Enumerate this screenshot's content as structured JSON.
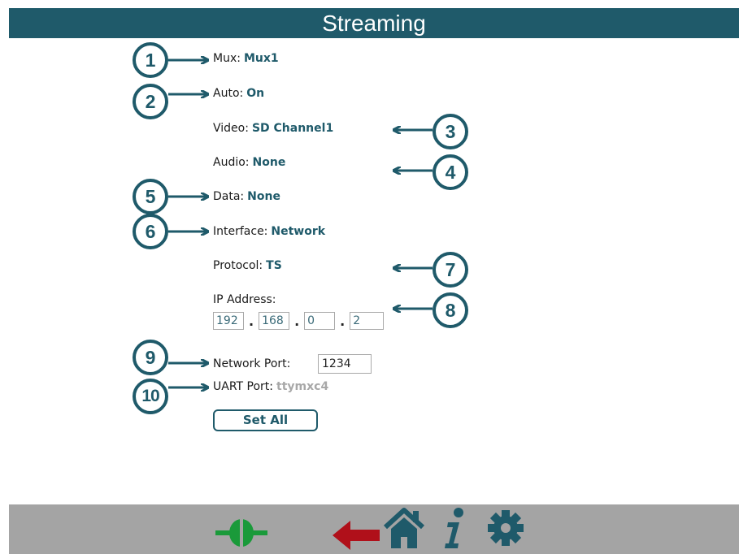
{
  "header": {
    "title": "Streaming"
  },
  "fields": {
    "mux": {
      "label": "Mux:",
      "value": "Mux1"
    },
    "auto": {
      "label": "Auto:",
      "value": "On"
    },
    "video": {
      "label": "Video:",
      "value": "SD Channel1"
    },
    "audio": {
      "label": "Audio:",
      "value": "None"
    },
    "data": {
      "label": "Data:",
      "value": "None"
    },
    "interface": {
      "label": "Interface:",
      "value": "Network"
    },
    "protocol": {
      "label": "Protocol:",
      "value": "TS"
    },
    "ip": {
      "label": "IP Address:",
      "octets": [
        "192",
        "168",
        "0",
        "2"
      ],
      "separator": "."
    },
    "network_port": {
      "label": "Network Port:",
      "value": "1234"
    },
    "uart_port": {
      "label": "UART Port:",
      "value": "ttymxc4"
    }
  },
  "buttons": {
    "set_all": "Set All"
  },
  "callouts": [
    "1",
    "2",
    "3",
    "4",
    "5",
    "6",
    "7",
    "8",
    "9",
    "10"
  ],
  "footer_icons": [
    "connection-plug-icon",
    "back-arrow-icon",
    "home-icon",
    "info-icon",
    "gear-icon"
  ],
  "colors": {
    "primary": "#1f5a6a",
    "connected_green": "#1a9a3a",
    "back_red": "#b0101a",
    "footer_bg": "#a4a4a4"
  }
}
